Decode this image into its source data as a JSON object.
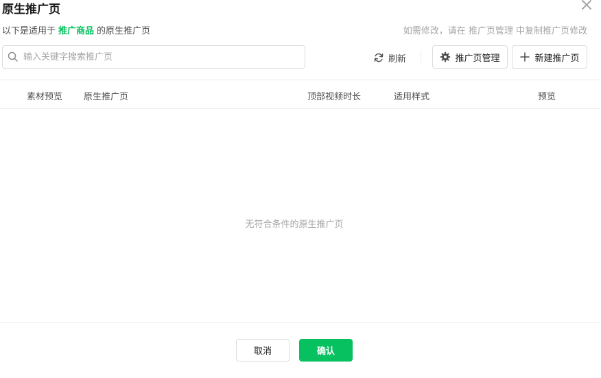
{
  "dialog": {
    "title": "原生推广页",
    "subtitle_prefix": "以下是适用于",
    "subtitle_highlight": "推广商品",
    "subtitle_suffix": "的原生推广页",
    "hint": "如需修改，请在 推广页管理 中复制推广页修改"
  },
  "search": {
    "placeholder": "输入关键字搜索推广页",
    "value": ""
  },
  "toolbar": {
    "refresh_label": "刷新",
    "manage_label": "推广页管理",
    "new_label": "新建推广页"
  },
  "table": {
    "columns": [
      "素材预览",
      "原生推广页",
      "顶部视频时长",
      "适用样式",
      "预览"
    ],
    "rows": [],
    "empty_text": "无符合条件的原生推广页"
  },
  "footer": {
    "cancel_label": "取消",
    "confirm_label": "确认"
  },
  "colors": {
    "accent": "#07c160",
    "border": "#dcdcdc",
    "muted_text": "#a6a6a6"
  },
  "icons": {
    "close": "close-icon",
    "search": "search-icon",
    "refresh": "refresh-icon",
    "settings": "gear-icon",
    "add": "plus-icon"
  }
}
